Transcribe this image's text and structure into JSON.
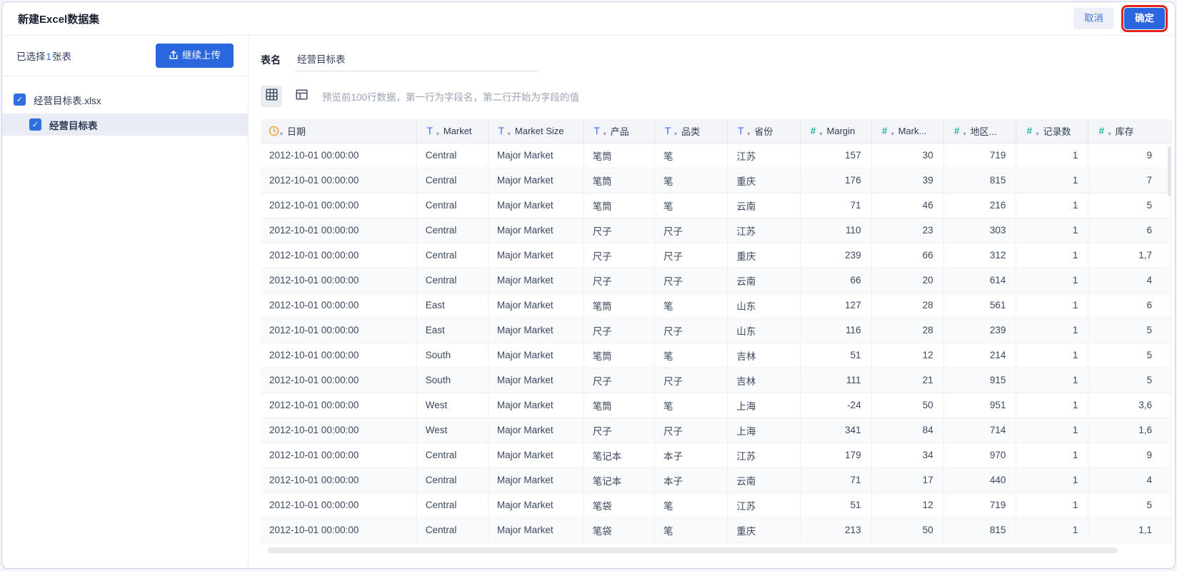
{
  "topbar": {
    "title": "新建Excel数据集",
    "cancel_label": "取消",
    "confirm_label": "确定"
  },
  "sidebar": {
    "selected_prefix": "已选择",
    "selected_count": "1",
    "selected_suffix": "张表",
    "upload_label": "继续上传",
    "file_name": "经营目标表.xlsx",
    "sheet_name": "经营目标表"
  },
  "main": {
    "table_name_label": "表名",
    "table_name_value": "经营目标表",
    "hint": "预览前100行数据，第一行为字段名，第二行开始为字段的值"
  },
  "table": {
    "columns": [
      {
        "label": "日期",
        "type": "date"
      },
      {
        "label": "Market",
        "type": "text"
      },
      {
        "label": "Market Size",
        "type": "text"
      },
      {
        "label": "产品",
        "type": "text"
      },
      {
        "label": "品类",
        "type": "text"
      },
      {
        "label": "省份",
        "type": "text"
      },
      {
        "label": "Margin",
        "type": "number"
      },
      {
        "label": "Mark...",
        "type": "number"
      },
      {
        "label": "地区...",
        "type": "number"
      },
      {
        "label": "记录数",
        "type": "number"
      },
      {
        "label": "库存",
        "type": "number"
      }
    ],
    "rows": [
      [
        "2012-10-01 00:00:00",
        "Central",
        "Major Market",
        "笔筒",
        "笔",
        "江苏",
        "157",
        "30",
        "719",
        "1",
        "9"
      ],
      [
        "2012-10-01 00:00:00",
        "Central",
        "Major Market",
        "笔筒",
        "笔",
        "重庆",
        "176",
        "39",
        "815",
        "1",
        "7"
      ],
      [
        "2012-10-01 00:00:00",
        "Central",
        "Major Market",
        "笔筒",
        "笔",
        "云南",
        "71",
        "46",
        "216",
        "1",
        "5"
      ],
      [
        "2012-10-01 00:00:00",
        "Central",
        "Major Market",
        "尺子",
        "尺子",
        "江苏",
        "110",
        "23",
        "303",
        "1",
        "6"
      ],
      [
        "2012-10-01 00:00:00",
        "Central",
        "Major Market",
        "尺子",
        "尺子",
        "重庆",
        "239",
        "66",
        "312",
        "1",
        "1,7"
      ],
      [
        "2012-10-01 00:00:00",
        "Central",
        "Major Market",
        "尺子",
        "尺子",
        "云南",
        "66",
        "20",
        "614",
        "1",
        "4"
      ],
      [
        "2012-10-01 00:00:00",
        "East",
        "Major Market",
        "笔筒",
        "笔",
        "山东",
        "127",
        "28",
        "561",
        "1",
        "6"
      ],
      [
        "2012-10-01 00:00:00",
        "East",
        "Major Market",
        "尺子",
        "尺子",
        "山东",
        "116",
        "28",
        "239",
        "1",
        "5"
      ],
      [
        "2012-10-01 00:00:00",
        "South",
        "Major Market",
        "笔筒",
        "笔",
        "吉林",
        "51",
        "12",
        "214",
        "1",
        "5"
      ],
      [
        "2012-10-01 00:00:00",
        "South",
        "Major Market",
        "尺子",
        "尺子",
        "吉林",
        "111",
        "21",
        "915",
        "1",
        "5"
      ],
      [
        "2012-10-01 00:00:00",
        "West",
        "Major Market",
        "笔筒",
        "笔",
        "上海",
        "-24",
        "50",
        "951",
        "1",
        "3,6"
      ],
      [
        "2012-10-01 00:00:00",
        "West",
        "Major Market",
        "尺子",
        "尺子",
        "上海",
        "341",
        "84",
        "714",
        "1",
        "1,6"
      ],
      [
        "2012-10-01 00:00:00",
        "Central",
        "Major Market",
        "笔记本",
        "本子",
        "江苏",
        "179",
        "34",
        "970",
        "1",
        "9"
      ],
      [
        "2012-10-01 00:00:00",
        "Central",
        "Major Market",
        "笔记本",
        "本子",
        "云南",
        "71",
        "17",
        "440",
        "1",
        "4"
      ],
      [
        "2012-10-01 00:00:00",
        "Central",
        "Major Market",
        "笔袋",
        "笔",
        "江苏",
        "51",
        "12",
        "719",
        "1",
        "5"
      ],
      [
        "2012-10-01 00:00:00",
        "Central",
        "Major Market",
        "笔袋",
        "笔",
        "重庆",
        "213",
        "50",
        "815",
        "1",
        "1,1"
      ]
    ]
  },
  "colors": {
    "primary_blue": "#2a66dd",
    "icon_text_blue": "#3370f0",
    "icon_number_teal": "#2bb3a3",
    "icon_date_orange": "#f0a32f",
    "annotation_red": "#e3241b",
    "header_bg": "#f3f5f8",
    "selected_row_bg": "#e9edf3"
  }
}
